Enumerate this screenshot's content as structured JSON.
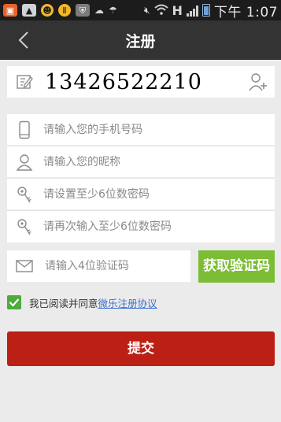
{
  "status_bar": {
    "carrier_h": "H",
    "time": "下午 1:07"
  },
  "header": {
    "title": "注册"
  },
  "form": {
    "account_value": "13426522210",
    "phone_placeholder": "请输入您的手机号码",
    "nickname_placeholder": "请输入您的昵称",
    "password_placeholder": "请设置至少6位数密码",
    "password_confirm_placeholder": "请再次输入至少6位数密码",
    "code_placeholder": "请输入4位验证码",
    "get_code_label": "获取验证码",
    "agree_text": "我已阅读并同意",
    "agree_link": "微乐注册协议",
    "agree_checked": true,
    "submit_label": "提交"
  },
  "colors": {
    "header_bg": "#333333",
    "get_code_bg": "#7cbd35",
    "submit_bg": "#bc1f14",
    "checkbox": "#4dab3a",
    "link": "#3a6fd0"
  }
}
